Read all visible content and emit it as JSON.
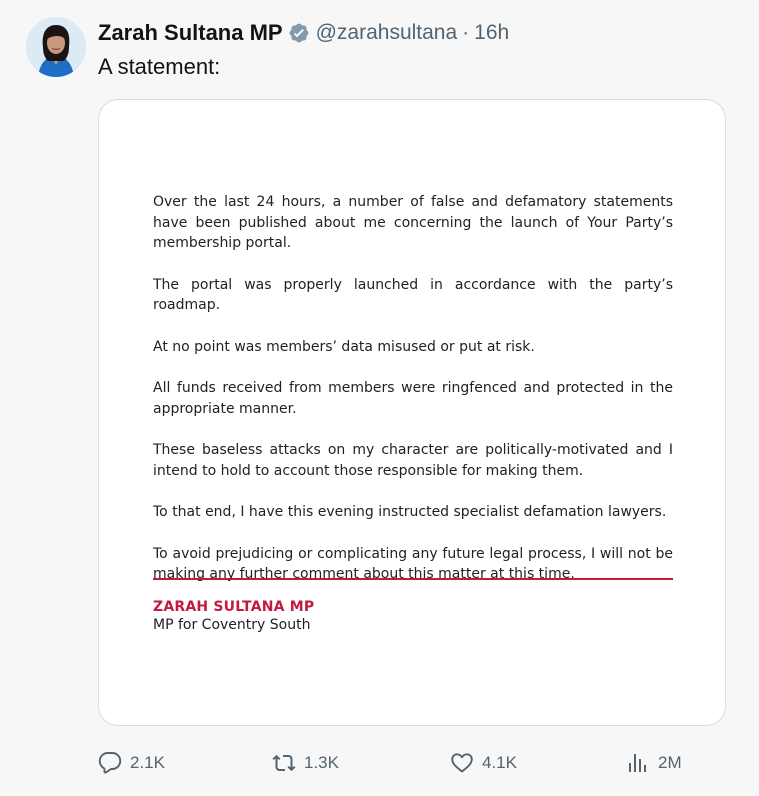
{
  "author": {
    "name": "Zarah Sultana MP",
    "handle": "@zarahsultana",
    "separator": "·",
    "time": "16h",
    "verified_badge_color": "#829aab"
  },
  "tweet": {
    "text": "A statement:"
  },
  "statement": {
    "paragraphs": [
      "Over the last 24 hours, a number of false and defamatory statements have been published about me concerning the launch of Your Party’s membership portal.",
      "The portal was properly launched in accordance with the party’s roadmap.",
      "At no point was members’ data misused or put at risk.",
      "All funds received from members were ringfenced and protected in the appropriate manner.",
      "These baseless attacks on my character are politically-motivated and I intend to hold to account those responsible for making them.",
      "To that end, I have this evening instructed specialist defamation lawyers.",
      "To avoid prejudicing or complicating any future legal process, I will not be making any further comment about this matter at this time."
    ],
    "signature_name": "ZARAH SULTANA MP",
    "signature_title": "MP for Coventry South",
    "accent_color": "#c31b3f"
  },
  "actions": {
    "reply": {
      "count": "2.1K",
      "icon": "reply-icon"
    },
    "retweet": {
      "count": "1.3K",
      "icon": "retweet-icon"
    },
    "like": {
      "count": "4.1K",
      "icon": "heart-icon"
    },
    "views": {
      "count": "2M",
      "icon": "views-icon"
    }
  }
}
